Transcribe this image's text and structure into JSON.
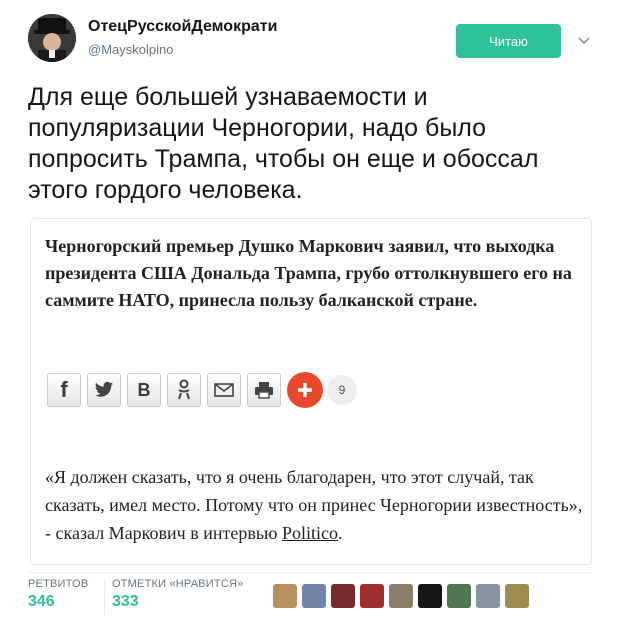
{
  "author": {
    "name": "ОтецРусскойДемократи",
    "handle": "@Mayskolpino",
    "avatar_icon": "user-avatar-icon"
  },
  "header": {
    "follow_label": "Читаю",
    "menu_icon": "chevron-down-icon",
    "accent_color": "#2fc298"
  },
  "tweet": {
    "text": "Для еще большей узнаваемости и популяризации Черногории, надо было попросить Трампа, чтобы он еще и обоссал этого гордого человека."
  },
  "card": {
    "lead": "Черногорский премьер Душко Маркович заявил, что выходка президента США Дональда Трампа, грубо оттолкнувшего его на саммите НАТО, принесла пользу балканской стране.",
    "share_buttons": [
      {
        "label": "f",
        "icon": "facebook-icon"
      },
      {
        "label": "twitter",
        "icon": "twitter-icon"
      },
      {
        "label": "B",
        "icon": "vk-icon"
      },
      {
        "label": "ok",
        "icon": "odnoklassniki-icon"
      },
      {
        "label": "mail",
        "icon": "mail-icon"
      },
      {
        "label": "print",
        "icon": "print-icon"
      }
    ],
    "share_more_icon": "plus-icon",
    "share_count": "9",
    "quote_text": "«Я должен сказать, что я очень благодарен, что этот случай, так сказать, имел место. Потому что он принес Черногории известность», - сказал Маркович в интервью ",
    "quote_link": "Politico",
    "quote_end": "."
  },
  "stats": {
    "retweets_label": "РЕТВИТОВ",
    "retweets_value": "346",
    "likes_label": "ОТМЕТКИ «НРАВИТСЯ»",
    "likes_value": "333"
  },
  "likers": [
    "liker-avatar-icon",
    "liker-avatar-icon",
    "liker-avatar-icon",
    "liker-avatar-icon",
    "liker-avatar-icon",
    "liker-avatar-icon",
    "liker-avatar-icon",
    "liker-avatar-icon",
    "liker-avatar-icon"
  ]
}
